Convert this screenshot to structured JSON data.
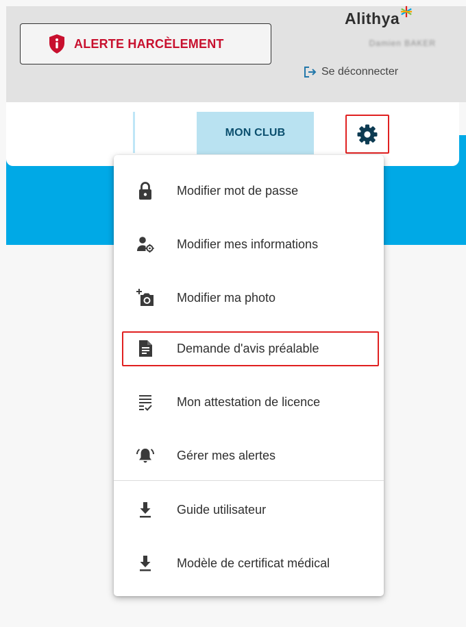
{
  "header": {
    "alert_label": "ALERTE HARCÈLEMENT",
    "brand": "Alithya",
    "user_name": "Damien BAKER",
    "logout_label": "Se déconnecter"
  },
  "nav": {
    "club_tab": "MON CLUB"
  },
  "menu": {
    "items": [
      {
        "label": "Modifier mot de passe",
        "icon": "lock-icon"
      },
      {
        "label": "Modifier mes informations",
        "icon": "user-settings-icon"
      },
      {
        "label": "Modifier ma photo",
        "icon": "add-photo-icon"
      },
      {
        "label": "Demande d'avis préalable",
        "icon": "document-icon"
      },
      {
        "label": "Mon attestation de licence",
        "icon": "checklist-icon"
      },
      {
        "label": "Gérer mes alertes",
        "icon": "alarm-bell-icon"
      },
      {
        "label": "Guide utilisateur",
        "icon": "download-icon"
      },
      {
        "label": "Modèle de certificat médical",
        "icon": "download-icon"
      }
    ]
  },
  "colors": {
    "alert_red": "#c8102e",
    "highlight_red": "#e02020",
    "brand_blue": "#00a9e6",
    "tab_bg": "#b9e2f1",
    "icon_dark": "#0d3b52"
  }
}
